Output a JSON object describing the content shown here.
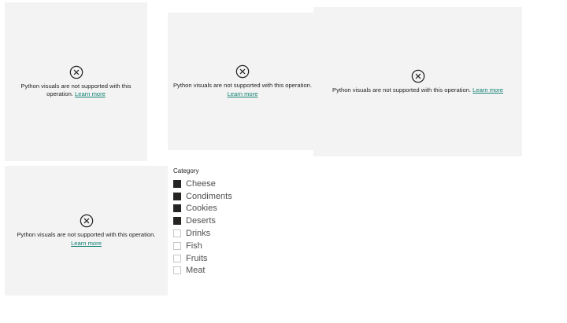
{
  "tiles": [
    {
      "message": "Python visuals are not supported with this operation.",
      "link": "Learn more"
    },
    {
      "message": "Python visuals are not supported with this operation.",
      "link": "Learn more"
    },
    {
      "message": "Python visuals are not supported with this operation.",
      "link": "Learn more"
    },
    {
      "message": "Python visuals are not supported with this operation.",
      "link": "Learn more"
    }
  ],
  "slicer": {
    "header": "Category",
    "items": [
      {
        "label": "Cheese",
        "checked": true
      },
      {
        "label": "Condiments",
        "checked": true
      },
      {
        "label": "Cookies",
        "checked": true
      },
      {
        "label": "Deserts",
        "checked": true
      },
      {
        "label": "Drinks",
        "checked": false
      },
      {
        "label": "Fish",
        "checked": false
      },
      {
        "label": "Fruits",
        "checked": false
      },
      {
        "label": "Meat",
        "checked": false
      }
    ]
  },
  "colors": {
    "link": "#118275",
    "tile_bg": "#f3f3f3",
    "checked": "#252423"
  },
  "icons": {
    "error": "circle-x-icon"
  }
}
